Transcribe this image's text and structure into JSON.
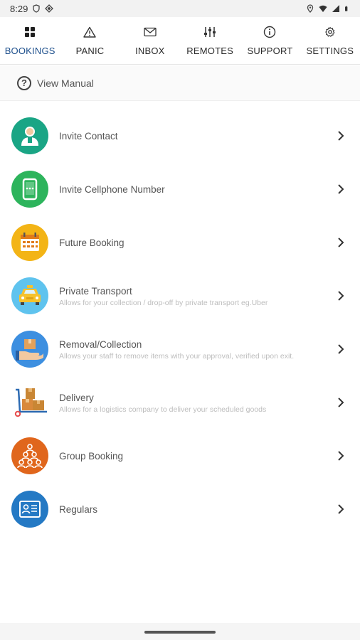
{
  "status_bar": {
    "time": "8:29"
  },
  "tabs": [
    {
      "label": "BOOKINGS",
      "icon": "grid-icon",
      "active": true
    },
    {
      "label": "PANIC",
      "icon": "warning-icon",
      "active": false
    },
    {
      "label": "INBOX",
      "icon": "mail-icon",
      "active": false
    },
    {
      "label": "REMOTES",
      "icon": "sliders-icon",
      "active": false
    },
    {
      "label": "SUPPORT",
      "icon": "info-icon",
      "active": false
    },
    {
      "label": "SETTINGS",
      "icon": "gear-icon",
      "active": false
    }
  ],
  "manual": {
    "label": "View Manual"
  },
  "items": [
    {
      "title": "Invite Contact",
      "subtitle": "",
      "icon": "contact-icon",
      "color": "#1aa585"
    },
    {
      "title": "Invite Cellphone Number",
      "subtitle": "",
      "icon": "cellphone-icon",
      "color": "#2db45c"
    },
    {
      "title": "Future Booking",
      "subtitle": "",
      "icon": "calendar-icon",
      "color": "#f3b416"
    },
    {
      "title": "Private Transport",
      "subtitle": "Allows for your collection / drop-off by private transport eg.Uber",
      "icon": "taxi-icon",
      "color": "#5fc3ee"
    },
    {
      "title": "Removal/Collection",
      "subtitle": "Allows your staff to remove items with your approval, verified upon exit.",
      "icon": "package-hand-icon",
      "color": "#3d8fe0"
    },
    {
      "title": "Delivery",
      "subtitle": "Allows for a logistics company to deliver your scheduled goods",
      "icon": "delivery-trolley-icon",
      "color": "#d9893b"
    },
    {
      "title": "Group Booking",
      "subtitle": "",
      "icon": "group-icon",
      "color": "#e0661c"
    },
    {
      "title": "Regulars",
      "subtitle": "",
      "icon": "id-card-icon",
      "color": "#2479c4"
    }
  ]
}
